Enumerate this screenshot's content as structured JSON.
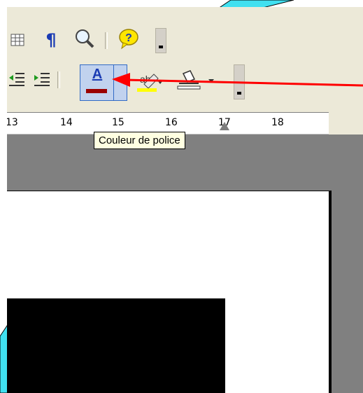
{
  "toolbar_top": {
    "icons": [
      "table-icon",
      "pilcrow-icon",
      "zoom-icon",
      "help-icon"
    ],
    "pilcrow_glyph": "¶",
    "help_glyph": "?"
  },
  "toolbar_format": {
    "icons": [
      "decrease-indent-icon",
      "increase-indent-icon",
      "font-color-icon",
      "highlight-icon",
      "background-color-icon"
    ],
    "font_color_letter": "A",
    "font_color_bar": "#9b0000",
    "highlight_color": "#ffff00"
  },
  "ruler": {
    "ticks": [
      "13",
      "14",
      "15",
      "16",
      "17",
      "18"
    ]
  },
  "tooltip": {
    "text": "Couleur de police"
  },
  "colors": {
    "chrome": "#ece9d8",
    "doc_background": "#808080",
    "accent_cyan": "#40e0f0",
    "annotation_red": "#ff0000"
  }
}
